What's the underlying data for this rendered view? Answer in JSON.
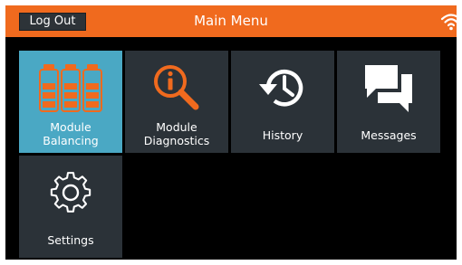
{
  "header": {
    "title": "Main Menu",
    "logout_label": "Log Out",
    "bar_color": "#f06a1e"
  },
  "status": {
    "wifi_icon": "wifi-icon"
  },
  "tiles": [
    {
      "name": "module-balancing",
      "line1": "Module",
      "line2": "Balancing",
      "icon": "battery-modules-icon",
      "active": true
    },
    {
      "name": "module-diagnostics",
      "line1": "Module",
      "line2": "Diagnostics",
      "icon": "info-magnifier-icon",
      "active": false
    },
    {
      "name": "history",
      "line1": "History",
      "icon": "history-clock-icon",
      "active": false
    },
    {
      "name": "messages",
      "line1": "Messages",
      "icon": "messages-icon",
      "active": false
    },
    {
      "name": "settings",
      "line1": "Settings",
      "icon": "gear-icon",
      "active": false
    }
  ],
  "colors": {
    "accent_orange": "#f06a1e",
    "tile_bg": "#2b3238",
    "tile_active": "#4aa8c4"
  }
}
